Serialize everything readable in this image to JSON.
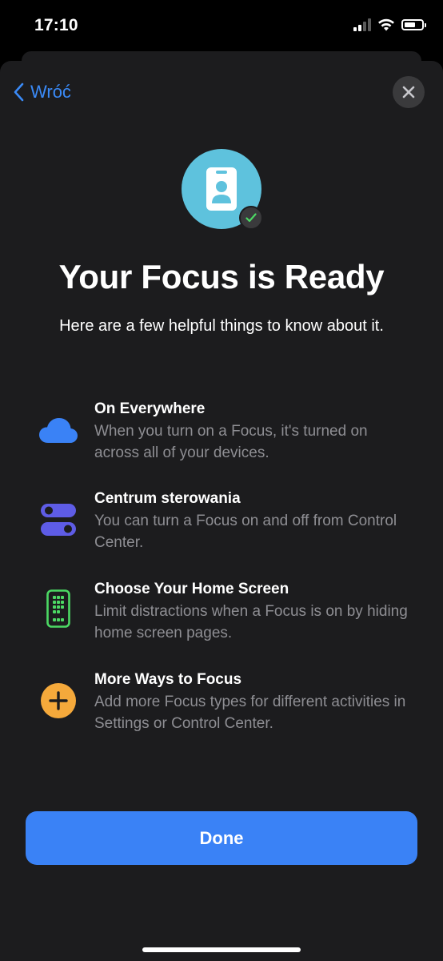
{
  "status_bar": {
    "time": "17:10"
  },
  "nav": {
    "back_label": "Wróć"
  },
  "hero": {
    "title": "Your Focus is Ready",
    "subtitle": "Here are a few helpful things to know about it."
  },
  "features": [
    {
      "icon": "cloud-icon",
      "title": "On Everywhere",
      "description": "When you turn on a Focus, it's turned on across all of your devices."
    },
    {
      "icon": "toggles-icon",
      "title": "Centrum sterowania",
      "description": "You can turn a Focus on and off from Control Center."
    },
    {
      "icon": "home-screen-icon",
      "title": "Choose Your Home Screen",
      "description": "Limit distractions when a Focus is on by hiding home screen pages."
    },
    {
      "icon": "plus-circle-icon",
      "title": "More Ways to Focus",
      "description": "Add more Focus types for different activities in Settings or Control Center."
    }
  ],
  "done_label": "Done",
  "colors": {
    "accent": "#3a82f6",
    "hero_icon_bg": "#5ec2dd",
    "cloud": "#3a82f6",
    "toggles": "#5e5ce6",
    "home_screen": "#4cd964",
    "plus": "#f5a93b"
  }
}
